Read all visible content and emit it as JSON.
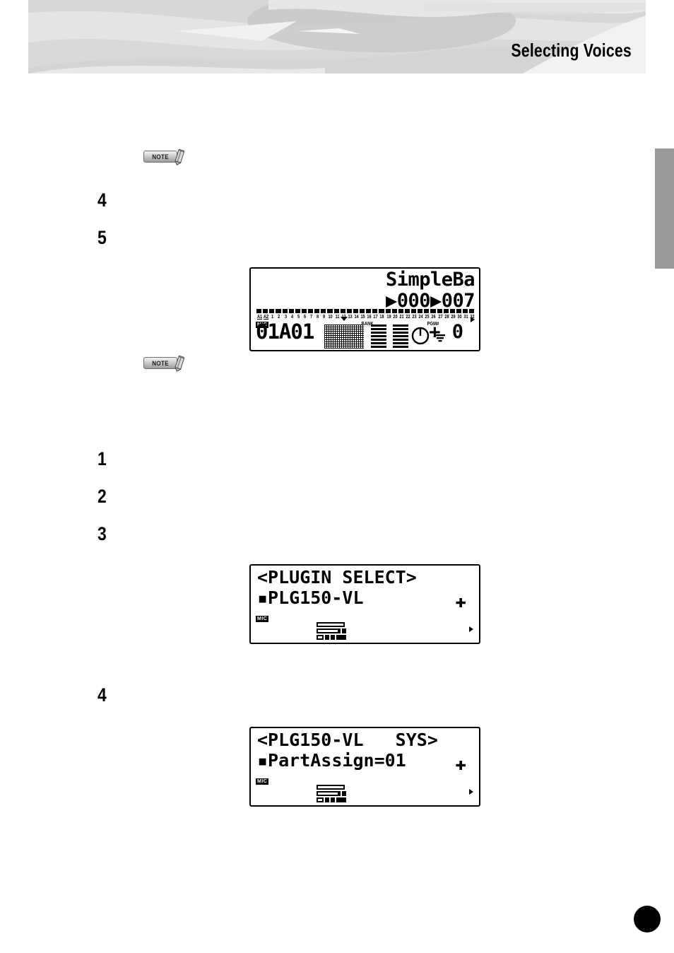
{
  "header": {
    "title": "Selecting Voices"
  },
  "steps": {
    "group_a": [
      "4",
      "5"
    ],
    "group_b": [
      "1",
      "2",
      "3"
    ],
    "group_c": [
      "4"
    ]
  },
  "notes": {
    "label": "NOTE",
    "icon": "note-pencil-icon"
  },
  "lcd_voice": {
    "voice_name": "SimpleBa",
    "bank_value": "▶000",
    "pgm_value": "▶007",
    "numbers": [
      "A1",
      "A2",
      "1",
      "2",
      "3",
      "4",
      "5",
      "6",
      "7",
      "8",
      "9",
      "10",
      "11",
      "12",
      "13",
      "14",
      "15",
      "16",
      "17",
      "18",
      "19",
      "20",
      "21",
      "22",
      "23",
      "24",
      "25",
      "26",
      "27",
      "28",
      "29",
      "30",
      "31",
      "32"
    ],
    "bank_label": "BANK",
    "pgm_label": "PGM#",
    "mic_label": "MIC",
    "part_id": "01A01",
    "transpose": "+ 0"
  },
  "lcd_plugin_select": {
    "title": "<PLUGIN SELECT>",
    "value": "▪PLG150-VL",
    "cursor_glyph": "✚",
    "mic_label": "MIC"
  },
  "lcd_plg_sys": {
    "title": "<PLG150-VL   SYS>",
    "value": "▪PartAssign=01",
    "cursor_glyph": "✚",
    "mic_label": "MIC"
  },
  "side_tab": {
    "name": "chapter-thumb-tab"
  },
  "page_marker": {
    "name": "page-number-dot"
  }
}
